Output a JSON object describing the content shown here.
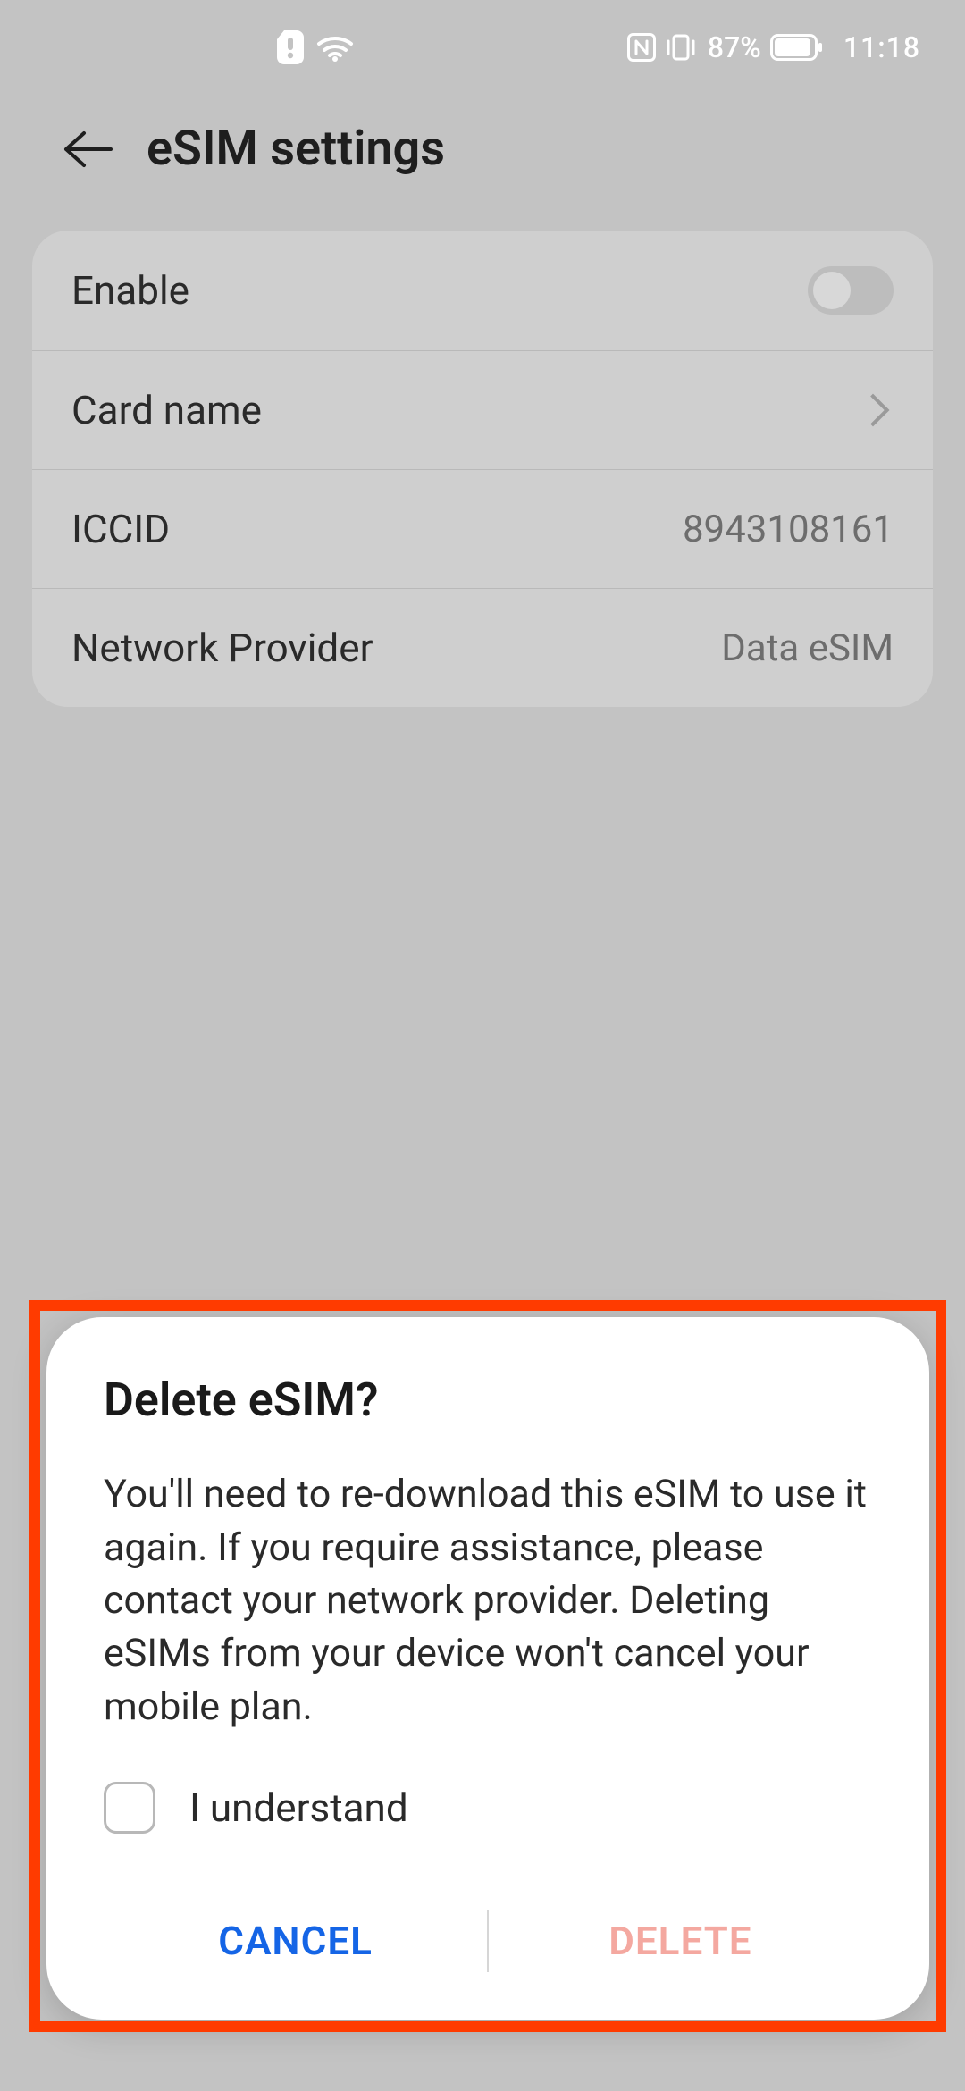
{
  "status": {
    "battery_pct": "87%",
    "time": "11:18"
  },
  "header": {
    "title": "eSIM settings"
  },
  "rows": {
    "enable_label": "Enable",
    "enable_on": false,
    "card_name_label": "Card name",
    "iccid_label": "ICCID",
    "iccid_value": "8943108161",
    "provider_label": "Network Provider",
    "provider_value": "Data eSIM"
  },
  "dialog": {
    "title": "Delete eSIM?",
    "body": "You'll need to re-download this eSIM to use it again. If you require assistance, please contact your network provider. Deleting eSIMs from your device won't cancel your mobile plan.",
    "checkbox_label": "I understand",
    "checkbox_checked": false,
    "cancel": "CANCEL",
    "delete": "DELETE",
    "delete_enabled": false
  }
}
